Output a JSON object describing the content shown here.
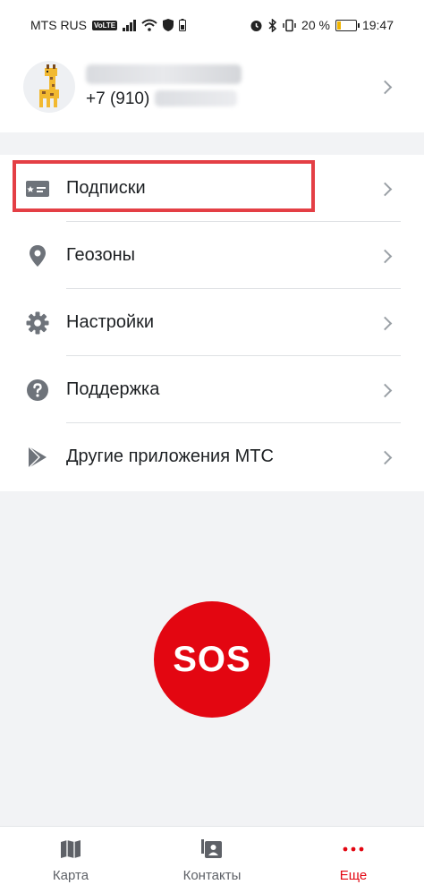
{
  "status_bar": {
    "carrier": "MTS RUS",
    "volte": "VoLTE",
    "battery": "20 %",
    "time": "19:47"
  },
  "profile": {
    "phone_prefix": "+7 (910)"
  },
  "menu": {
    "items": [
      {
        "label": "Подписки",
        "icon": "subscription-card-icon"
      },
      {
        "label": "Геозоны",
        "icon": "location-pin-icon"
      },
      {
        "label": "Настройки",
        "icon": "gear-icon"
      },
      {
        "label": "Поддержка",
        "icon": "help-icon"
      },
      {
        "label": "Другие приложения МТС",
        "icon": "play-store-icon"
      }
    ]
  },
  "sos": {
    "label": "SOS"
  },
  "tabbar": {
    "tabs": [
      {
        "label": "Карта",
        "icon": "map-icon"
      },
      {
        "label": "Контакты",
        "icon": "contacts-icon"
      },
      {
        "label": "Еще",
        "icon": "more-dots-icon"
      }
    ],
    "active_index": 2
  },
  "colors": {
    "accent": "#e30611",
    "highlight": "#e43f45"
  }
}
